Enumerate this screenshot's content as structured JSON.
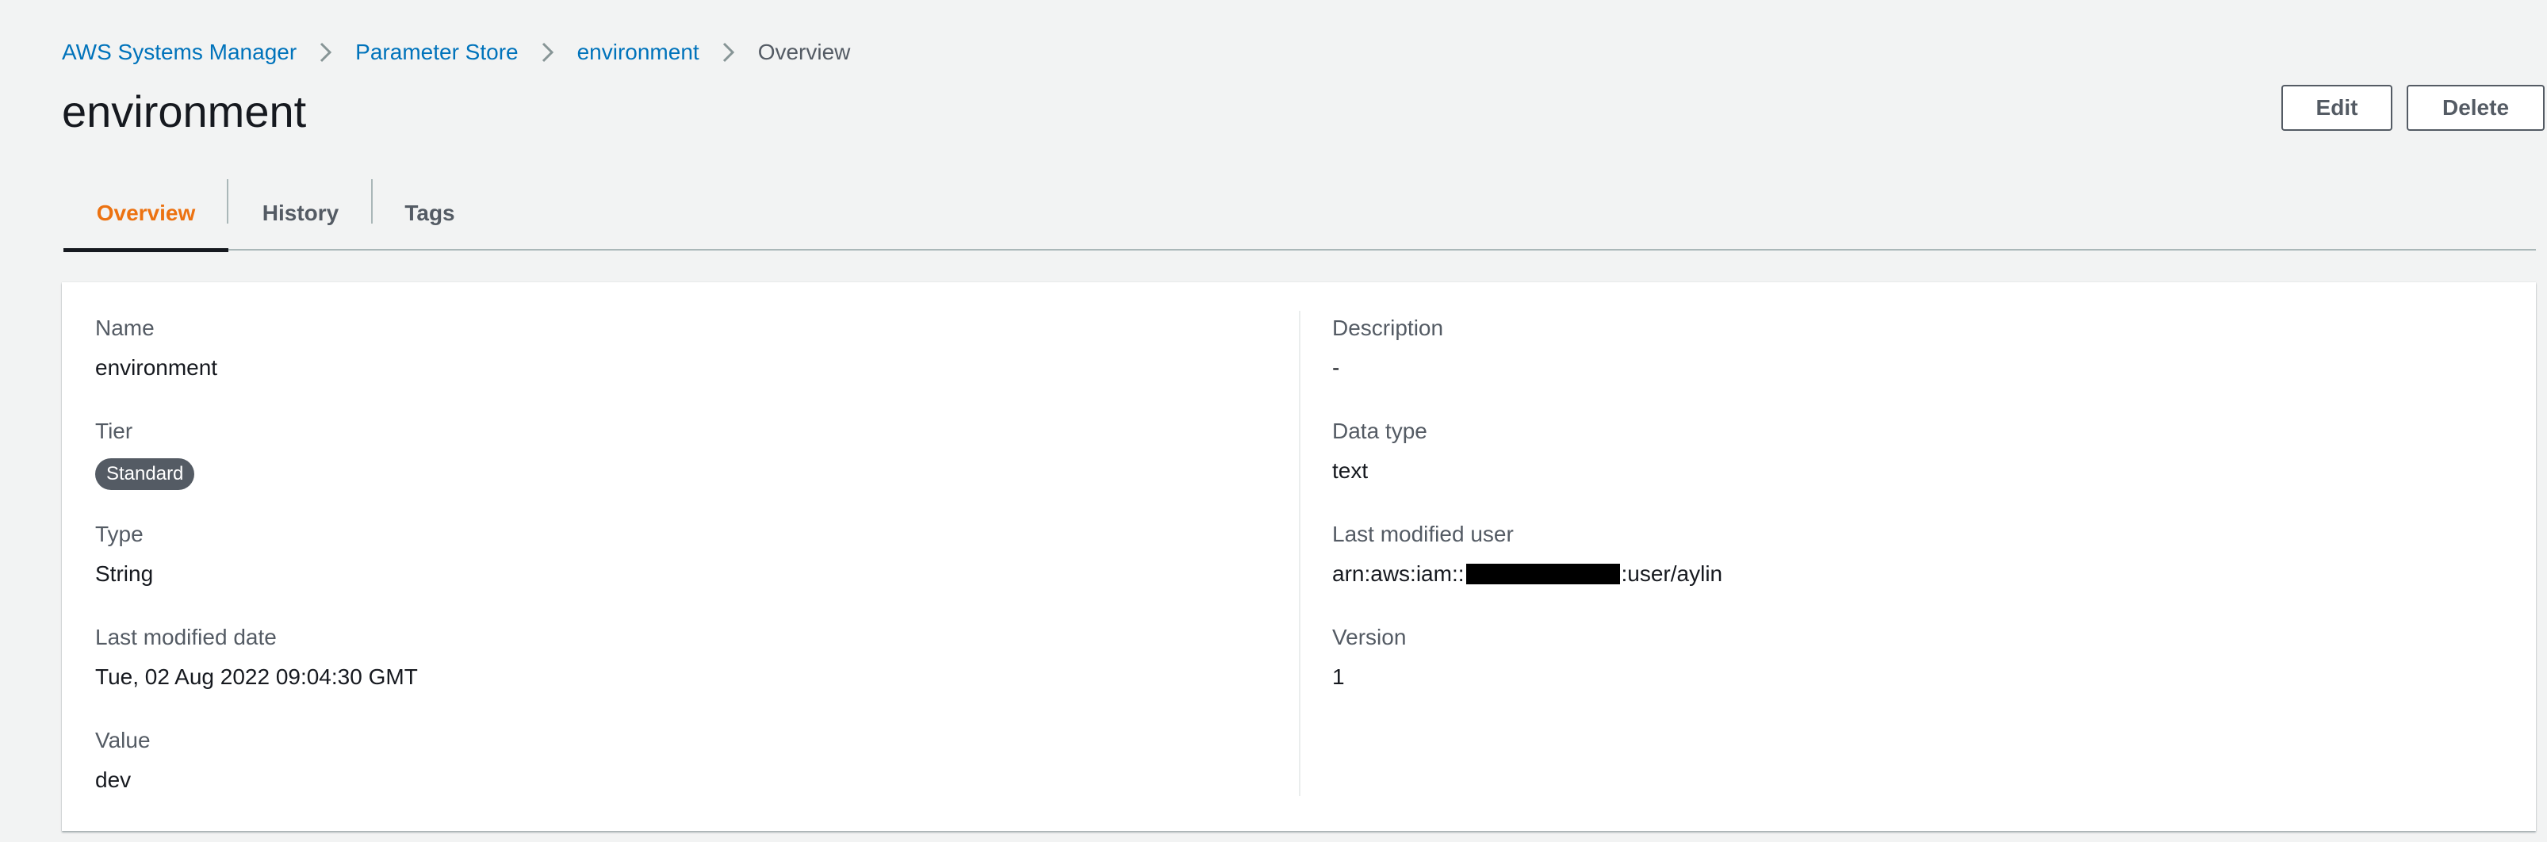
{
  "breadcrumb": {
    "items": [
      "AWS Systems Manager",
      "Parameter Store",
      "environment"
    ],
    "current": "Overview"
  },
  "page_title": "environment",
  "actions": {
    "edit_label": "Edit",
    "delete_label": "Delete"
  },
  "tabs": [
    {
      "label": "Overview",
      "active": true
    },
    {
      "label": "History",
      "active": false
    },
    {
      "label": "Tags",
      "active": false
    }
  ],
  "details": {
    "left": {
      "name": {
        "label": "Name",
        "value": "environment"
      },
      "tier": {
        "label": "Tier",
        "value": "Standard"
      },
      "type": {
        "label": "Type",
        "value": "String"
      },
      "last_modified_date": {
        "label": "Last modified date",
        "value": "Tue, 02 Aug 2022 09:04:30 GMT"
      },
      "value": {
        "label": "Value",
        "value": "dev"
      }
    },
    "right": {
      "description": {
        "label": "Description",
        "value": "-"
      },
      "data_type": {
        "label": "Data type",
        "value": "text"
      },
      "last_modified_user": {
        "label": "Last modified user",
        "value_prefix": "arn:aws:iam::",
        "value_suffix": ":user/aylin"
      },
      "version": {
        "label": "Version",
        "value": "1"
      }
    }
  },
  "colors": {
    "link": "#0073bb",
    "active_tab": "#ec7211",
    "text": "#16191f",
    "secondary_text": "#545b64",
    "badge_bg": "#545b64",
    "background": "#f2f3f3"
  },
  "icons": {
    "breadcrumb_separator": "chevron-right-icon"
  }
}
